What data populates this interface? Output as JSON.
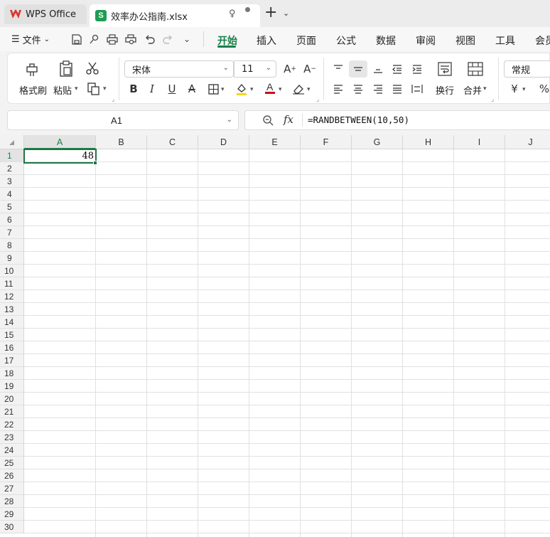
{
  "tabs": {
    "app_label": "WPS Office",
    "doc_label": "效率办公指南.xlsx",
    "doc_icon_letter": "S"
  },
  "menu": {
    "file_label": "文件",
    "tabs": [
      "开始",
      "插入",
      "页面",
      "公式",
      "数据",
      "审阅",
      "视图",
      "工具",
      "会员"
    ],
    "active_tab": "开始"
  },
  "ribbon": {
    "format_painter_label": "格式刷",
    "paste_label": "粘贴",
    "font_name": "宋体",
    "font_size": "11",
    "wrap_label": "换行",
    "merge_label": "合并",
    "number_format": "常规",
    "currency_symbol": "¥",
    "percent_symbol": "%"
  },
  "formula_bar": {
    "name_box": "A1",
    "fx_label": "fx",
    "formula": "=RANDBETWEEN(10,50)"
  },
  "sheet": {
    "columns": [
      "A",
      "B",
      "C",
      "D",
      "E",
      "F",
      "G",
      "H",
      "I",
      "J"
    ],
    "rows": [
      "1",
      "2",
      "3",
      "4",
      "5",
      "6",
      "7",
      "8",
      "9",
      "10",
      "11",
      "12",
      "13",
      "14",
      "15",
      "16",
      "17",
      "18",
      "19",
      "20",
      "21",
      "22",
      "23",
      "24",
      "25",
      "26",
      "27",
      "28",
      "29",
      "30"
    ],
    "selected_column": "A",
    "selected_row": "1",
    "cells": {
      "A1": "48"
    }
  },
  "colors": {
    "accent": "#1a7f4a",
    "selection_border": "#217346"
  }
}
